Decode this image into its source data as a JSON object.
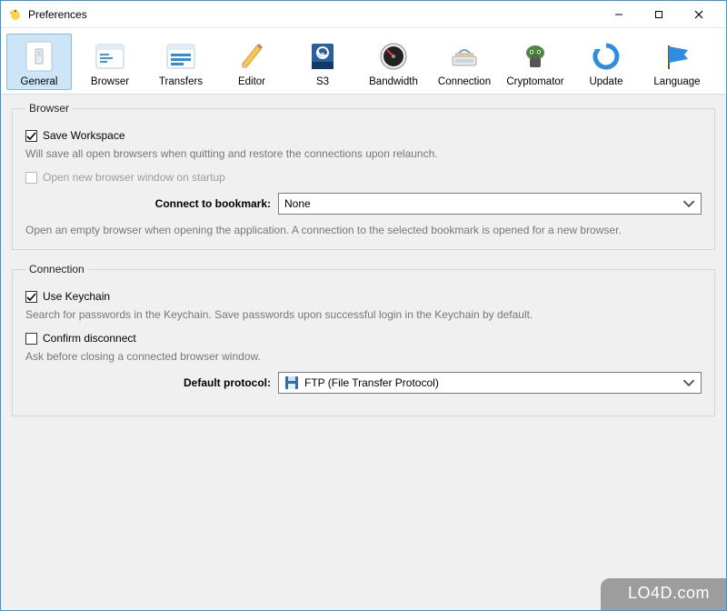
{
  "window": {
    "title": "Preferences"
  },
  "toolbar": {
    "items": [
      {
        "id": "general",
        "label": "General",
        "selected": true
      },
      {
        "id": "browser",
        "label": "Browser",
        "selected": false
      },
      {
        "id": "transfers",
        "label": "Transfers",
        "selected": false
      },
      {
        "id": "editor",
        "label": "Editor",
        "selected": false
      },
      {
        "id": "s3",
        "label": "S3",
        "selected": false
      },
      {
        "id": "bandwidth",
        "label": "Bandwidth",
        "selected": false
      },
      {
        "id": "connection",
        "label": "Connection",
        "selected": false
      },
      {
        "id": "cryptomator",
        "label": "Cryptomator",
        "selected": false
      },
      {
        "id": "update",
        "label": "Update",
        "selected": false
      },
      {
        "id": "language",
        "label": "Language",
        "selected": false
      }
    ]
  },
  "groups": {
    "browser": {
      "legend": "Browser",
      "save_workspace": {
        "label": "Save Workspace",
        "checked": true,
        "desc": "Will save all open browsers when quitting and restore the connections upon relaunch."
      },
      "open_new_on_startup": {
        "label": "Open new browser window on startup",
        "checked": false,
        "enabled": false
      },
      "connect_bookmark": {
        "label": "Connect to bookmark:",
        "value": "None",
        "desc": "Open an empty browser when opening the application. A connection to the selected bookmark is opened for a new browser."
      }
    },
    "connection": {
      "legend": "Connection",
      "use_keychain": {
        "label": "Use Keychain",
        "checked": true,
        "desc": "Search for passwords in the Keychain. Save passwords upon successful login in the Keychain by default."
      },
      "confirm_disconnect": {
        "label": "Confirm disconnect",
        "checked": false,
        "desc": "Ask before closing a connected browser window."
      },
      "default_protocol": {
        "label": "Default protocol:",
        "value": "FTP (File Transfer Protocol)"
      }
    }
  },
  "watermark": "LO4D.com"
}
